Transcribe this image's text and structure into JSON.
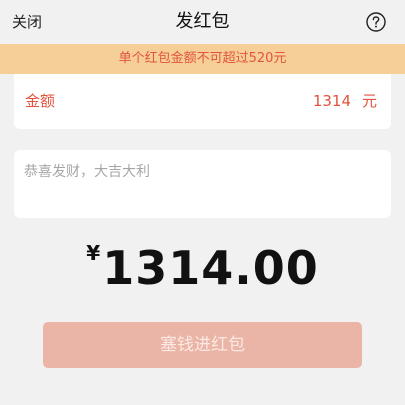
{
  "navbar": {
    "close_label": "关闭",
    "title": "发红包",
    "help_icon": "question-circle-icon"
  },
  "notice": {
    "text": "单个红包金额不可超过520元"
  },
  "amount": {
    "label": "金额",
    "value": "1314",
    "unit": "元"
  },
  "greeting": {
    "placeholder": "恭喜发财，大吉大利"
  },
  "total": {
    "currency_symbol": "¥",
    "value": "1314.00"
  },
  "submit": {
    "label": "塞钱进红包"
  },
  "colors": {
    "accent_red": "#e2543d",
    "notice_bg": "#f6cf98",
    "button_bg": "#eab4a6",
    "page_bg": "#f1f1f1"
  }
}
